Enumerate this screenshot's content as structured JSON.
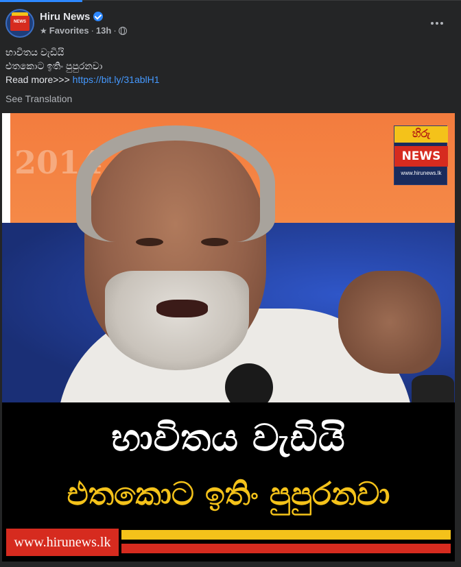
{
  "post": {
    "page_name": "Hiru News",
    "favorites_label": "Favorites",
    "time_ago": "13h",
    "separator": "·",
    "text_line1": "භාවිතය වැඩියි",
    "text_line2": "එතකොට ඉතිං පුපුරනවා",
    "read_more_prefix": "Read more>>> ",
    "link_text": "https://bit.ly/31ablH1",
    "see_translation": "See Translation"
  },
  "avatar": {
    "logo_text": "NEWS"
  },
  "image": {
    "backdrop_text": "2014",
    "logo_top": "හිරු",
    "logo_mid": "NEWS",
    "logo_url": "www.hirunews.lk",
    "headline1": "භාවිතය වැඩියි",
    "headline2": "එතකොට ඉතිං පුපුරනවා",
    "footer_url": "www.hirunews.lk"
  },
  "colors": {
    "accent_link": "#4599ff",
    "brand_red": "#d62b1f",
    "brand_yellow": "#f4c21a",
    "background": "#242526"
  }
}
